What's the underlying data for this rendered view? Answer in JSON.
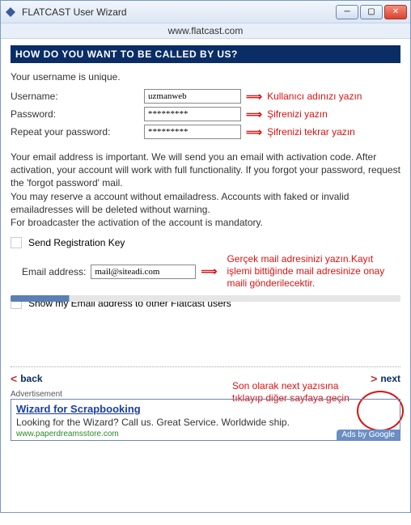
{
  "window": {
    "title": "FLATCAST User Wizard",
    "url": "www.flatcast.com"
  },
  "heading": "HOW DO YOU WANT TO BE CALLED BY US?",
  "subline": "Your username is unique.",
  "form": {
    "username_label": "Username:",
    "username_value": "uzmanweb",
    "username_note": "Kullanıcı adınızı yazın",
    "password_label": "Password:",
    "password_value": "*********",
    "password_note": "Şifrenizi yazın",
    "repeat_label": "Repeat your password:",
    "repeat_value": "*********",
    "repeat_note": "Şifrenizi tekrar yazın"
  },
  "paragraph": "Your email address is important. We will send you an email with activation code. After activation, your account will work with full functionality. If you forgot your password, request the 'forgot password' mail.\nYou may reserve a account without emailadress. Accounts with faked or invalid emailadresses will be deleted without warning.\nFor broadcaster the activation of the account is mandatory.",
  "send_reg_label": "Send Registration Key",
  "email_label": "Email address:",
  "email_value": "mail@siteadi.com",
  "email_note": "Gerçek mail adresinizi yazın.Kayıt işlemi bittiğinde mail adresinize onay maili gönderilecektir.",
  "show_email_label": "Show my Email address to other Flatcast users",
  "final_note": "Son olarak next yazısına tıklayıp diğer sayfaya geçin",
  "nav": {
    "back": "back",
    "next": "next"
  },
  "ad": {
    "section_label": "Advertisement",
    "title": "Wizard for Scrapbooking",
    "text": "Looking for the Wizard? Call us. Great Service. Worldwide ship.",
    "url": "www.paperdreamsstore.com",
    "badge": "Ads by Google"
  }
}
